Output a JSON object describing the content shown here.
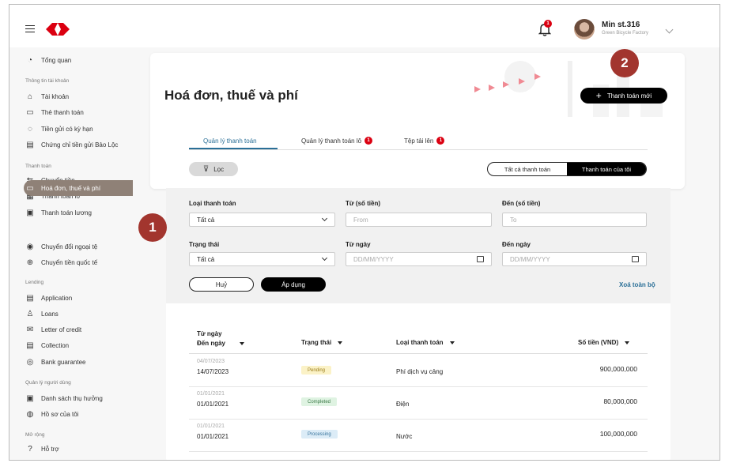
{
  "header": {
    "user_name": "Min st.316",
    "user_org": "Green Bicycle Factory",
    "notification_count": "1"
  },
  "sidebar": {
    "overview": "Tổng quan",
    "group_account_info": "Thông tin tài khoản",
    "accounts": "Tài khoản",
    "payment_cards": "Thẻ thanh toán",
    "term_deposit": "Tiền gửi có kỳ hạn",
    "deposit_cert": "Chứng chỉ tiền gửi Bảo Lộc",
    "group_payments": "Thanh toán",
    "transfer": "Chuyển tiền",
    "batch_payment": "Thanh toán lô",
    "payroll": "Thanh toán lương",
    "invoices": "Hoá đơn, thuế và phí",
    "fx": "Chuyển đổi ngoại tệ",
    "intl_transfer": "Chuyển tiền quốc tế",
    "group_lending": "Lending",
    "application": "Application",
    "loans": "Loans",
    "letter_of_credit": "Letter of credit",
    "collection": "Collection",
    "bank_guarantee": "Bank guarantee",
    "group_user_mgmt": "Quản lý người dùng",
    "beneficiaries": "Danh sách thụ hưởng",
    "profile": "Hồ sơ của tôi",
    "group_more": "Mở rộng",
    "support": "Hỗ trợ"
  },
  "callouts": [
    "1",
    "2"
  ],
  "page": {
    "title": "Hoá đơn, thuế và phí",
    "new_payment": "Thanh toán mới"
  },
  "tabs": [
    {
      "label": "Quản lý thanh toán",
      "badge": ""
    },
    {
      "label": "Quản lý thanh toán lô",
      "badge": "1"
    },
    {
      "label": "Tệp tải lên",
      "badge": "1"
    }
  ],
  "filter": {
    "button": "Lọc",
    "seg_all": "Tất cả thanh toán",
    "seg_mine": "Thanh toán của tôi",
    "payment_type_label": "Loại thanh toán",
    "payment_type_value": "Tất cả",
    "from_amount_label": "Từ (số tiền)",
    "from_amount_placeholder": "From",
    "to_amount_label": "Đến (số tiền)",
    "to_amount_placeholder": "To",
    "status_label": "Trạng thái",
    "status_value": "Tất cả",
    "from_date_label": "Từ ngày",
    "from_date_placeholder": "DD/MM/YYYY",
    "to_date_label": "Đến ngày",
    "to_date_placeholder": "DD/MM/YYYY",
    "cancel": "Huỷ",
    "apply": "Áp dụng",
    "clear_all": "Xoá toàn bộ"
  },
  "table": {
    "col_date_from": "Từ ngày",
    "col_date_to": "Đến ngày",
    "col_status": "Trạng thái",
    "col_type": "Loại thanh toán",
    "col_amount": "Số tiền (VND)",
    "rows": [
      {
        "from": "04/07/2023",
        "to": "14/07/2023",
        "status": "Pending",
        "type": "Phí dịch vụ cảng",
        "amount": "900,000,000"
      },
      {
        "from": "01/01/2021",
        "to": "01/01/2021",
        "status": "Completed",
        "type": "Điện",
        "amount": "80,000,000"
      },
      {
        "from": "01/01/2021",
        "to": "01/01/2021",
        "status": "Processing",
        "type": "Nước",
        "amount": "100,000,000"
      }
    ]
  },
  "colors": {
    "brand_red": "#db0011",
    "callout": "#a2352e",
    "active_nav": "#8f8177",
    "link_blue": "#2a6f97"
  }
}
